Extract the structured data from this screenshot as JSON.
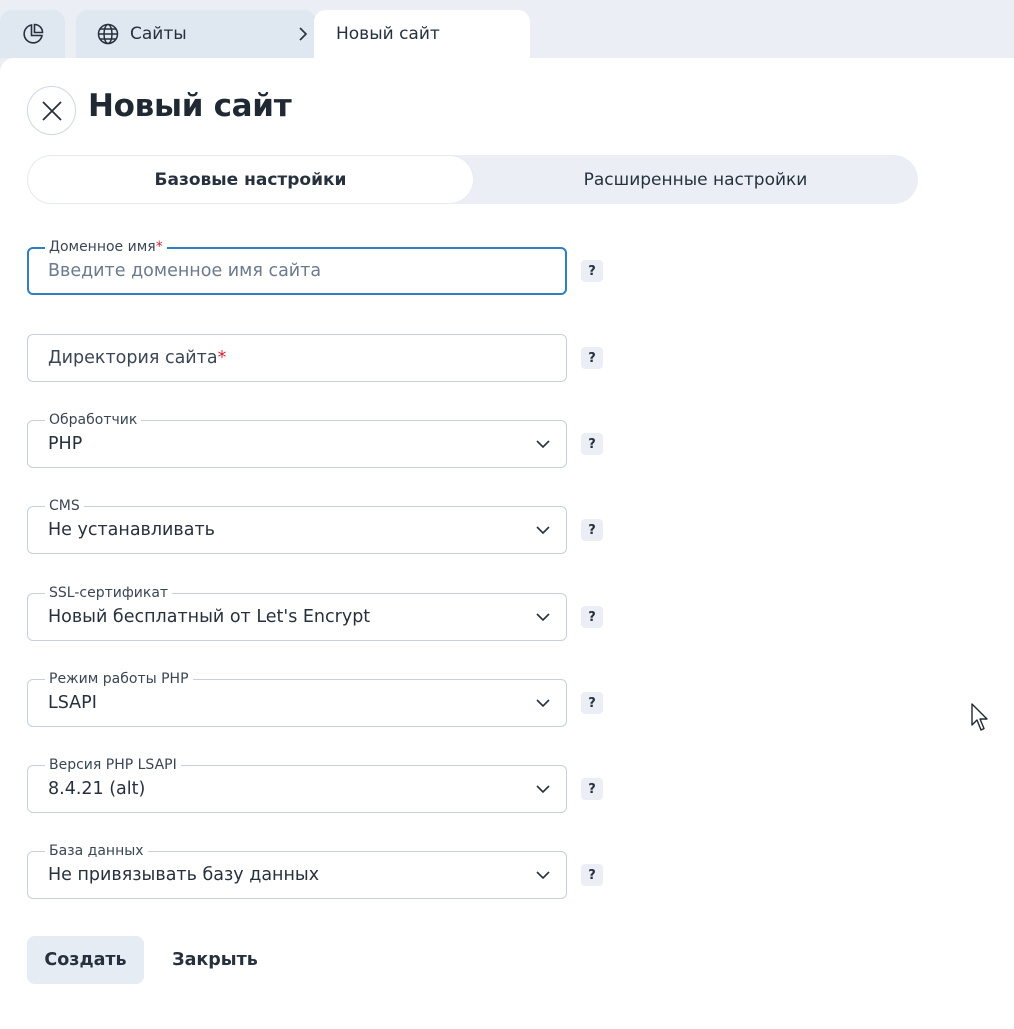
{
  "tabs": {
    "sites_label": "Сайты",
    "current_label": "Новый сайт"
  },
  "page": {
    "title": "Новый сайт"
  },
  "segment": {
    "basic": "Базовые настройки",
    "advanced": "Расширенные настройки"
  },
  "fields": {
    "domain": {
      "label": "Доменное имя",
      "required": "*",
      "placeholder": "Введите доменное имя сайта"
    },
    "directory": {
      "label": "Директория сайта",
      "required": "*"
    },
    "handler": {
      "label": "Обработчик",
      "value": "PHP"
    },
    "cms": {
      "label": "CMS",
      "value": "Не устанавливать"
    },
    "ssl": {
      "label": "SSL-сертификат",
      "value": "Новый бесплатный от Let's Encrypt"
    },
    "php_mode": {
      "label": "Режим работы PHP",
      "value": "LSAPI"
    },
    "php_version": {
      "label": "Версия PHP LSAPI",
      "value": "8.4.21 (alt)"
    },
    "database": {
      "label": "База данных",
      "value": "Не привязывать базу данных"
    }
  },
  "help_label": "?",
  "buttons": {
    "create": "Создать",
    "close": "Закрыть"
  },
  "icons": {
    "home": "pie-chart-icon",
    "sites": "globe-icon",
    "breadcrumb": "chevron-right-icon",
    "close": "close-icon",
    "dropdown": "chevron-down-icon"
  },
  "colors": {
    "accent": "#2f7fc1",
    "required": "#d1263b",
    "panel_bg": "#ebeff5"
  }
}
